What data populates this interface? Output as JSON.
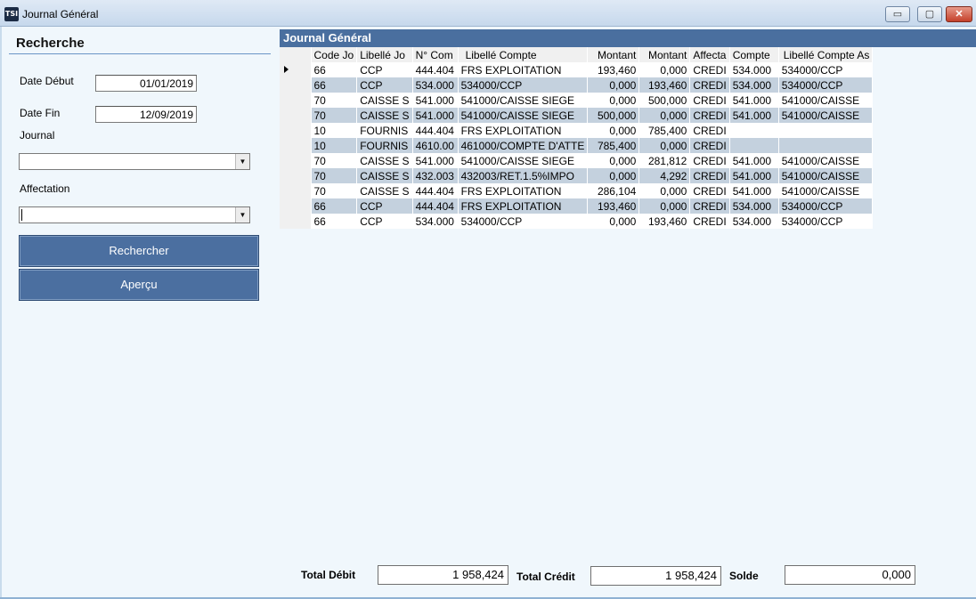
{
  "window": {
    "title": "Journal Général",
    "icon_text": "TSI",
    "controls": {
      "minimize": "▭",
      "maximize": "▢",
      "close": "✕"
    }
  },
  "search": {
    "title": "Recherche",
    "date_debut_label": "Date Début",
    "date_debut_value": "01/01/2019",
    "date_fin_label": "Date Fin",
    "date_fin_value": "12/09/2019",
    "journal_label": "Journal",
    "journal_value": "",
    "affectation_label": "Affectation",
    "affectation_value": "",
    "search_button": "Rechercher",
    "preview_button": "Aperçu"
  },
  "grid": {
    "title": "Journal Général",
    "columns": [
      "Code Jo",
      "Libellé Jo",
      "N° Com",
      "Libellé Compte",
      "Montant",
      "Montant",
      "Affecta",
      "Compte",
      "Libellé Compte As"
    ],
    "rows": [
      [
        "66",
        "CCP",
        "444.404",
        "FRS EXPLOITATION",
        "193,460",
        "0,000",
        "CREDI",
        "534.000",
        "534000/CCP"
      ],
      [
        "66",
        "CCP",
        "534.000",
        "534000/CCP",
        "0,000",
        "193,460",
        "CREDI",
        "534.000",
        "534000/CCP"
      ],
      [
        "70",
        "CAISSE S",
        "541.000",
        "541000/CAISSE SIEGE",
        "0,000",
        "500,000",
        "CREDI",
        "541.000",
        "541000/CAISSE"
      ],
      [
        "70",
        "CAISSE S",
        "541.000",
        "541000/CAISSE SIEGE",
        "500,000",
        "0,000",
        "CREDI",
        "541.000",
        "541000/CAISSE"
      ],
      [
        "10",
        "FOURNIS",
        "444.404",
        "FRS EXPLOITATION",
        "0,000",
        "785,400",
        "CREDI",
        "",
        ""
      ],
      [
        "10",
        "FOURNIS",
        "4610.00",
        "461000/COMPTE D'ATTE",
        "785,400",
        "0,000",
        "CREDI",
        "",
        ""
      ],
      [
        "70",
        "CAISSE S",
        "541.000",
        "541000/CAISSE SIEGE",
        "0,000",
        "281,812",
        "CREDI",
        "541.000",
        "541000/CAISSE"
      ],
      [
        "70",
        "CAISSE S",
        "432.003",
        "432003/RET.1.5%IMPO",
        "0,000",
        "4,292",
        "CREDI",
        "541.000",
        "541000/CAISSE"
      ],
      [
        "70",
        "CAISSE S",
        "444.404",
        "FRS EXPLOITATION",
        "286,104",
        "0,000",
        "CREDI",
        "541.000",
        "541000/CAISSE"
      ],
      [
        "66",
        "CCP",
        "444.404",
        "FRS EXPLOITATION",
        "193,460",
        "0,000",
        "CREDI",
        "534.000",
        "534000/CCP"
      ],
      [
        "66",
        "CCP",
        "534.000",
        "534000/CCP",
        "0,000",
        "193,460",
        "CREDI",
        "534.000",
        "534000/CCP"
      ]
    ]
  },
  "totals": {
    "debit_label": "Total Débit",
    "debit_value": "1 958,424",
    "credit_label": "Total Crédit",
    "credit_value": "1 958,424",
    "solde_label": "Solde",
    "solde_value": "0,000"
  }
}
